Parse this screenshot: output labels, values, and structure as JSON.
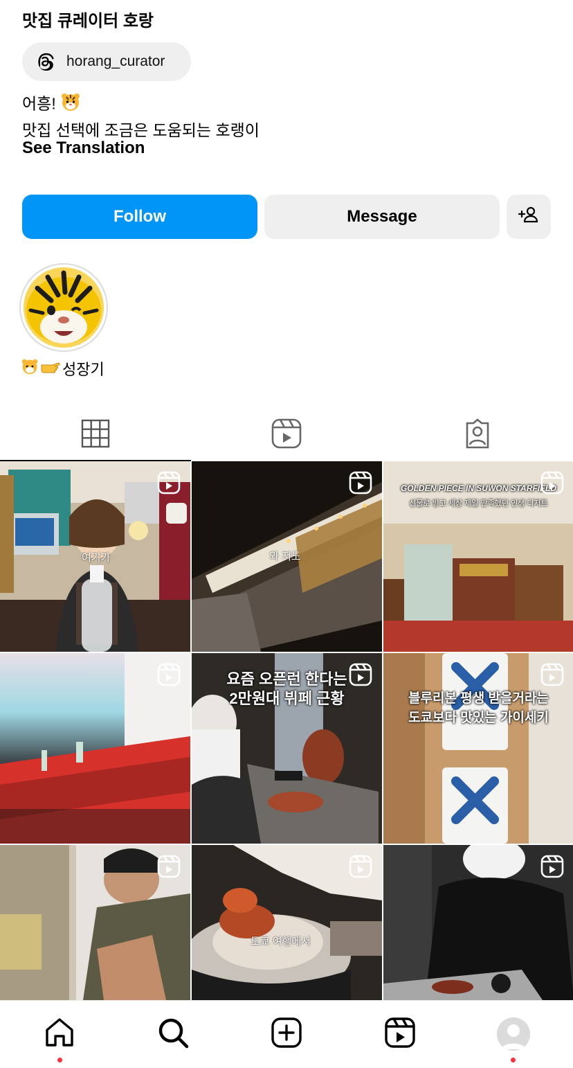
{
  "profile": {
    "display_name": "맛집 큐레이터 호랑",
    "threads_handle": "horang_curator",
    "bio_line1": "어흥!",
    "bio_line2": "맛집 선택에 조금은 도움되는 호랭이",
    "see_translation": "See Translation"
  },
  "actions": {
    "follow_label": "Follow",
    "message_label": "Message"
  },
  "highlights": [
    {
      "label": "성장기"
    }
  ],
  "tabs": [
    "posts-grid",
    "reels",
    "tagged"
  ],
  "grid": [
    {
      "overlay": "",
      "caption": "여기가"
    },
    {
      "overlay": "",
      "caption": "와 저도"
    },
    {
      "overlay": "GOLDEN PIECE IN SUWON STARFIELD",
      "overlay2": "선물로 받고 세상 제일 만족했던 인생 디저트",
      "caption": ""
    },
    {
      "overlay": "",
      "caption": ""
    },
    {
      "overlay": "요즘 오픈런 한다는",
      "overlay2": "2만원대 뷔페 근황",
      "caption": ""
    },
    {
      "overlay": "블루리본 평생 받을거라는",
      "overlay2": "도쿄보다 맛있는 가이세키",
      "caption": ""
    },
    {
      "overlay": "",
      "caption": ""
    },
    {
      "overlay": "",
      "caption": "도쿄 여행에서"
    },
    {
      "overlay": "",
      "caption": ""
    }
  ],
  "colors": {
    "follow_bg": "#0095f6",
    "secondary_bg": "#efefef",
    "notification_dot": "#ff3040"
  },
  "icons": {
    "threads": "threads-icon",
    "add_user": "add-user-icon",
    "home": "home-icon",
    "search": "search-icon",
    "create": "create-icon",
    "reels": "reels-icon",
    "profile": "profile-avatar"
  }
}
